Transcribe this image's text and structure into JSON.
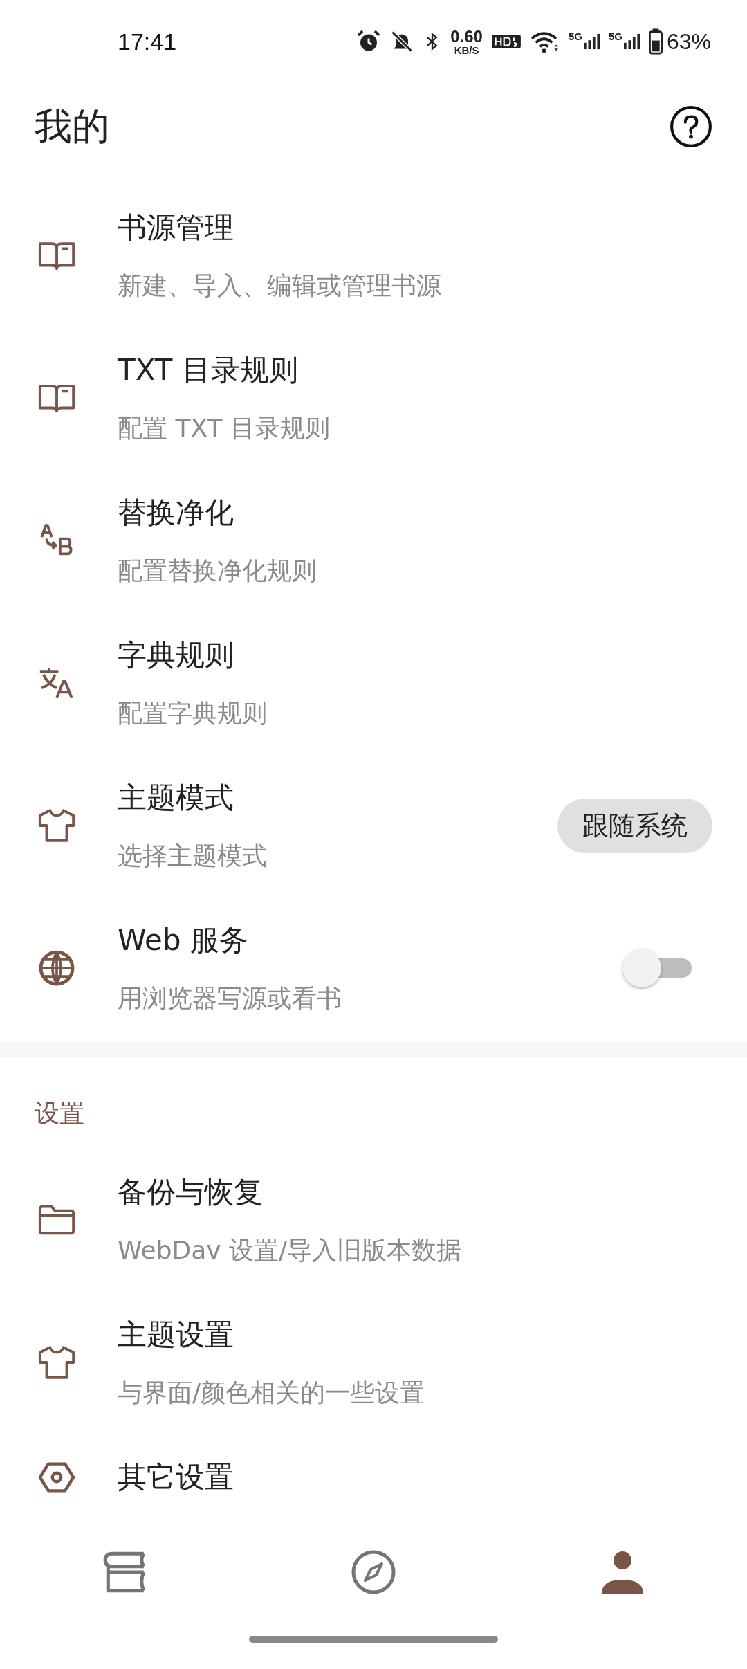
{
  "status_bar": {
    "time": "17:41",
    "speed_value": "0.60",
    "speed_unit": "KB/S",
    "signals": [
      "5G",
      "5G"
    ],
    "battery": "63%"
  },
  "header": {
    "title": "我的"
  },
  "items": [
    {
      "kind": "plain",
      "title": "书源管理",
      "subtitle": "新建、导入、编辑或管理书源"
    },
    {
      "kind": "plain",
      "title": "TXT 目录规则",
      "subtitle": "配置 TXT 目录规则"
    },
    {
      "kind": "plain",
      "title": "替换净化",
      "subtitle": "配置替换净化规则"
    },
    {
      "kind": "plain",
      "title": "字典规则",
      "subtitle": "配置字典规则"
    },
    {
      "kind": "chip",
      "title": "主题模式",
      "subtitle": "选择主题模式",
      "value": "跟随系统"
    },
    {
      "kind": "switch",
      "title": "Web 服务",
      "subtitle": "用浏览器写源或看书",
      "on": false
    }
  ],
  "settings_section": {
    "title": "设置",
    "items": [
      {
        "title": "备份与恢复",
        "subtitle": "WebDav 设置/导入旧版本数据"
      },
      {
        "title": "主题设置",
        "subtitle": "与界面/颜色相关的一些设置"
      },
      {
        "title": "其它设置"
      }
    ]
  },
  "bottom_nav": [
    {
      "selected": false
    },
    {
      "selected": false
    },
    {
      "selected": true
    }
  ]
}
